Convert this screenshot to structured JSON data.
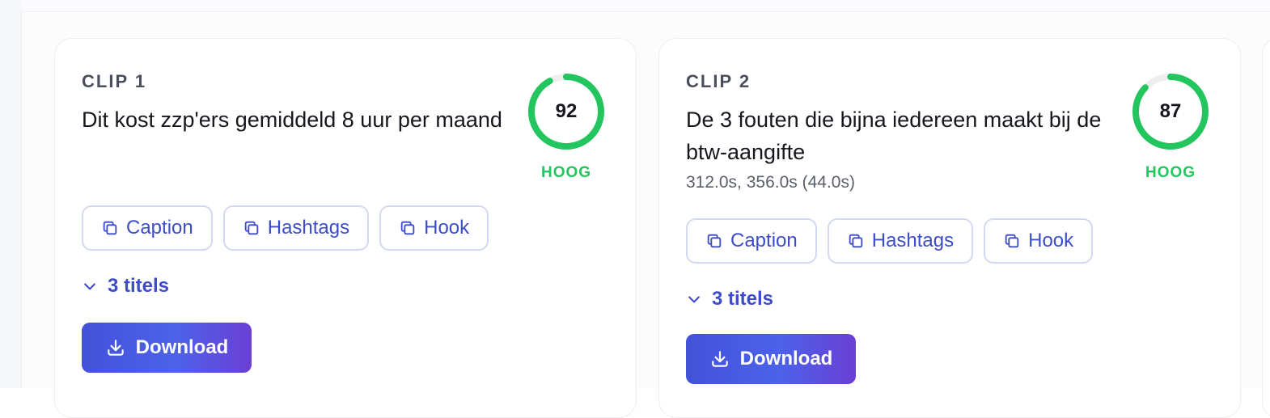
{
  "colors": {
    "accent": "#3d4cc8",
    "score_high": "#22c55e",
    "track": "#eeeeee"
  },
  "icons": {
    "copy": "copy-icon",
    "chevron": "chevron-down-icon",
    "download": "download-icon"
  },
  "clips": [
    {
      "label": "CLIP 1",
      "title": "Dit kost zzp'ers gemiddeld 8 uur per maand",
      "score": "92",
      "score_fraction": 0.92,
      "score_label": "HOOG",
      "buttons": {
        "caption": "Caption",
        "hashtags": "Hashtags",
        "hook": "Hook"
      },
      "titles_toggle": "3 titels",
      "download": "Download"
    },
    {
      "label": "CLIP 2",
      "title": "De 3 fouten die bijna iedereen maakt bij de btw-aangifte",
      "time": "312.0s, 356.0s (44.0s)",
      "score": "87",
      "score_fraction": 0.87,
      "score_label": "HOOG",
      "buttons": {
        "caption": "Caption",
        "hashtags": "Hashtags",
        "hook": "Hook"
      },
      "titles_toggle": "3 titels",
      "download": "Download"
    }
  ]
}
